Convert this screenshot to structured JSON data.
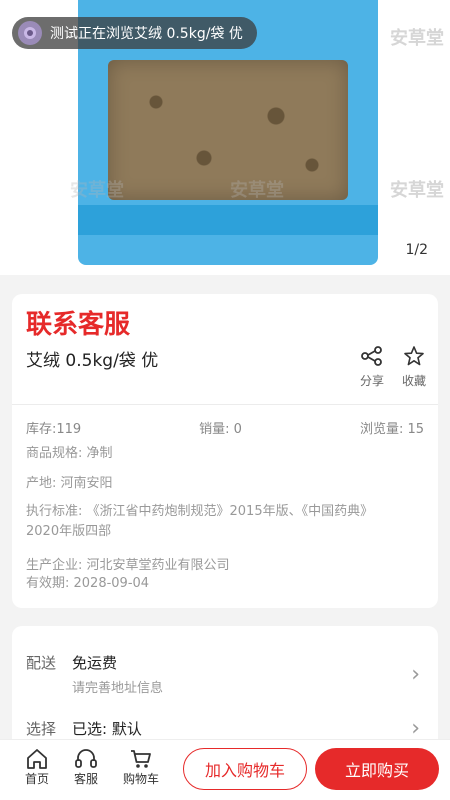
{
  "toast": {
    "text": "测试正在浏览艾绒 0.5kg/袋 优"
  },
  "gallery": {
    "page_indicator": "1/2",
    "watermark": "安草堂"
  },
  "product": {
    "contact_service": "联系客服",
    "name": "艾绒 0.5kg/袋 优",
    "share_label": "分享",
    "favorite_label": "收藏",
    "stock": "库存:119",
    "sales": "销量: 0",
    "views": "浏览量: 15",
    "spec": "商品规格: 净制",
    "origin": "产地: 河南安阳",
    "standard_line1": "执行标准: 《浙江省中药炮制规范》2015年版、《中国药典》",
    "standard_line2": "2020年版四部",
    "manufacturer": "生产企业: 河北安草堂药业有限公司",
    "expiry": "有效期: 2028-09-04"
  },
  "shipping": {
    "label": "配送",
    "value": "免运费",
    "sub": "请完善地址信息"
  },
  "selection": {
    "label": "选择",
    "value": "已选:  默认"
  },
  "bottom_bar": {
    "home": "首页",
    "service": "客服",
    "cart": "购物车",
    "add_to_cart": "加入购物车",
    "buy_now": "立即购买"
  },
  "colors": {
    "accent": "#e62a2a"
  }
}
